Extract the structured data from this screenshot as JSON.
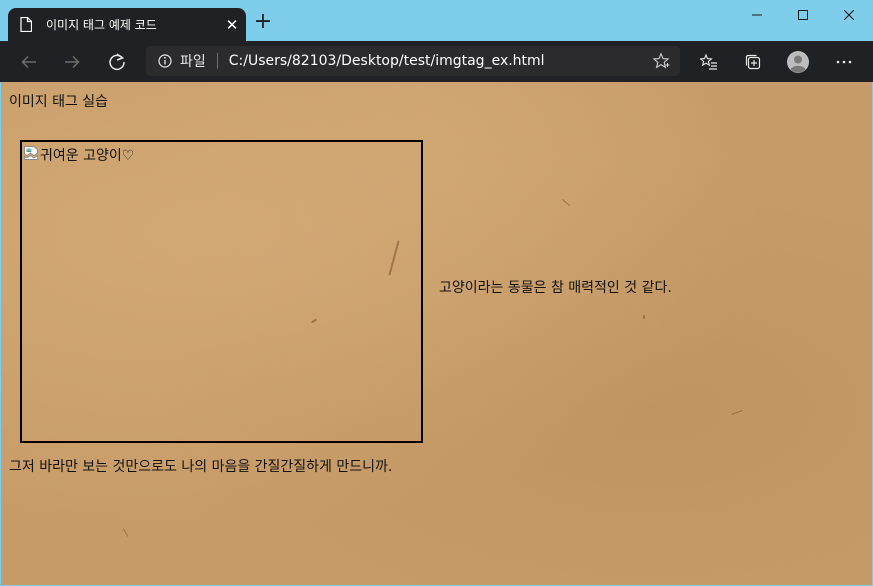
{
  "tab": {
    "title": "이미지 태그 예제 코드",
    "close": "✕",
    "new_tab": "+"
  },
  "window": {
    "minimize": "minimize",
    "maximize": "maximize",
    "close": "close"
  },
  "address_bar": {
    "scheme_label": "파일",
    "url": "C:/Users/82103/Desktop/test/imgtag_ex.html"
  },
  "page": {
    "heading": "이미지 태그 실습",
    "image_alt": "귀여운 고양이♡",
    "side_text": "고양이라는 동물은 참 매력적인 것 같다.",
    "bottom_text": "그저 바라만 보는 것만으로도 나의 마음을 간질간질하게 만드니까."
  },
  "colors": {
    "titlebar": "#7dcdeb",
    "toolbar": "#202124",
    "page_background": "#c79c68"
  }
}
